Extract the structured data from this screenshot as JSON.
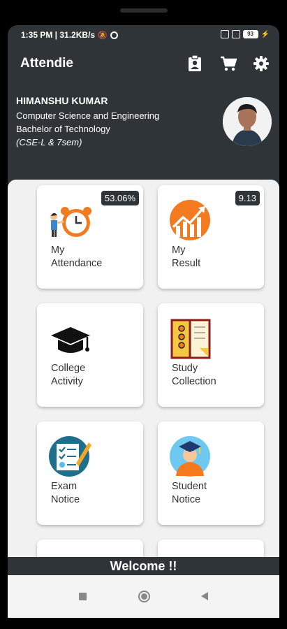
{
  "status": {
    "time_speed": "1:35 PM | 31.2KB/s",
    "battery": "93"
  },
  "app": {
    "title": "Attendie",
    "icons": [
      "clipboard-user-icon",
      "cart-icon",
      "gear-icon"
    ]
  },
  "profile": {
    "name": "HIMANSHU KUMAR",
    "department": "Computer Science and Engineering",
    "degree": "Bachelor of Technology",
    "section": "(CSE-L  & 7sem)"
  },
  "cards": [
    {
      "line1": "My",
      "line2": "Attendance",
      "badge": "53.06%",
      "icon": "alarm-clock-icon"
    },
    {
      "line1": "My",
      "line2": "Result",
      "badge": "9.13",
      "icon": "growth-chart-icon"
    },
    {
      "line1": "College",
      "line2": "Activity",
      "badge": "",
      "icon": "graduation-cap-icon"
    },
    {
      "line1": "Study",
      "line2": "Collection",
      "badge": "",
      "icon": "notebook-icon"
    },
    {
      "line1": "Exam",
      "line2": "Notice",
      "badge": "",
      "icon": "checklist-icon"
    },
    {
      "line1": "Student",
      "line2": "Notice",
      "badge": "",
      "icon": "graduate-student-icon"
    }
  ],
  "footer": {
    "welcome": "Welcome !!"
  },
  "nav": {
    "icons": [
      "recent-apps-icon",
      "home-icon",
      "back-icon"
    ]
  },
  "colors": {
    "dark": "#2f3438",
    "orange": "#f47a20",
    "teal": "#1d6f8c"
  }
}
